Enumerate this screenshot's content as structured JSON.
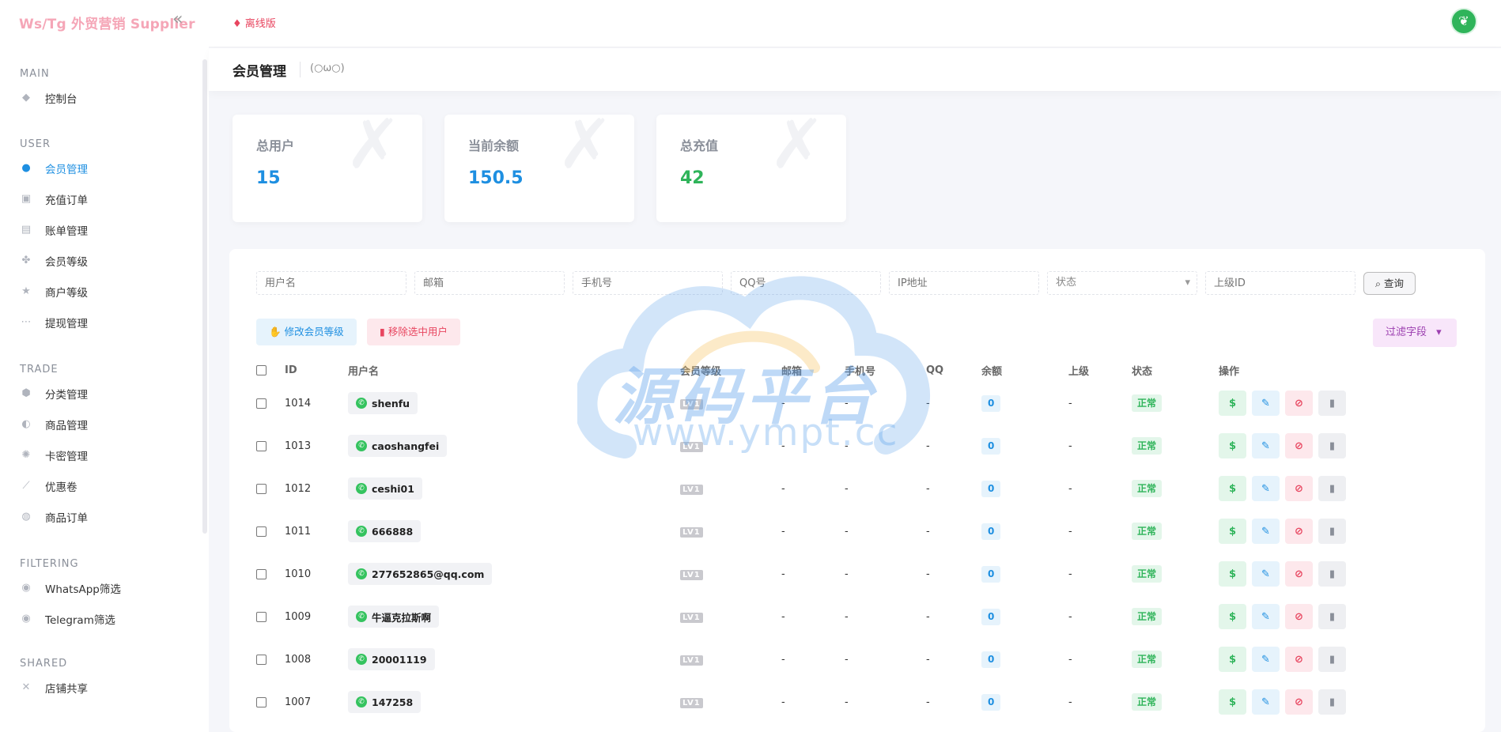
{
  "app": {
    "brand": "Ws/Tg 外贸营销 Supplier",
    "offline_label": "离线版"
  },
  "sidebar": {
    "groups": [
      {
        "title": "MAIN",
        "items": [
          {
            "label": "控制台",
            "icon": "dashboard-icon"
          }
        ]
      },
      {
        "title": "USER",
        "items": [
          {
            "label": "会员管理",
            "icon": "user-icon",
            "active": true
          },
          {
            "label": "充值订单",
            "icon": "recharge-icon"
          },
          {
            "label": "账单管理",
            "icon": "bill-icon"
          },
          {
            "label": "会员等级",
            "icon": "level-icon"
          },
          {
            "label": "商户等级",
            "icon": "merchant-icon"
          },
          {
            "label": "提现管理",
            "icon": "withdraw-icon"
          }
        ]
      },
      {
        "title": "TRADE",
        "items": [
          {
            "label": "分类管理",
            "icon": "category-icon"
          },
          {
            "label": "商品管理",
            "icon": "goods-icon"
          },
          {
            "label": "卡密管理",
            "icon": "card-key-icon"
          },
          {
            "label": "优惠卷",
            "icon": "coupon-icon"
          },
          {
            "label": "商品订单",
            "icon": "order-icon"
          }
        ]
      },
      {
        "title": "FILTERING",
        "items": [
          {
            "label": "WhatsApp筛选",
            "icon": "whatsapp-filter-icon"
          },
          {
            "label": "Telegram筛选",
            "icon": "telegram-filter-icon"
          }
        ]
      },
      {
        "title": "SHARED",
        "items": [
          {
            "label": "店铺共享",
            "icon": "share-icon"
          }
        ]
      }
    ]
  },
  "page": {
    "title": "会员管理",
    "face": "(○ω○)"
  },
  "stats": [
    {
      "label": "总用户",
      "value": "15",
      "color": "#1e8fe1"
    },
    {
      "label": "当前余额",
      "value": "150.5",
      "color": "#1e8fe1"
    },
    {
      "label": "总充值",
      "value": "42",
      "color": "#2fb45a"
    }
  ],
  "filters": {
    "username": "用户名",
    "email": "邮箱",
    "phone": "手机号",
    "qq": "QQ号",
    "ip": "IP地址",
    "status": "状态",
    "parent_id": "上级ID",
    "query_button": "查询"
  },
  "actions": {
    "edit_level": "修改会员等级",
    "remove_selected": "移除选中用户",
    "filter_fields": "过滤字段"
  },
  "table": {
    "columns": [
      "ID",
      "用户名",
      "会员等级",
      "邮箱",
      "手机号",
      "QQ",
      "余额",
      "上级",
      "状态",
      "操作"
    ],
    "rows": [
      {
        "id": "1014",
        "username": "shenfu",
        "level": "LV1",
        "email": "-",
        "phone": "-",
        "qq": "-",
        "balance": "0",
        "parent": "-",
        "status": "正常"
      },
      {
        "id": "1013",
        "username": "caoshangfei",
        "level": "LV1",
        "email": "-",
        "phone": "-",
        "qq": "-",
        "balance": "0",
        "parent": "-",
        "status": "正常"
      },
      {
        "id": "1012",
        "username": "ceshi01",
        "level": "LV1",
        "email": "-",
        "phone": "-",
        "qq": "-",
        "balance": "0",
        "parent": "-",
        "status": "正常"
      },
      {
        "id": "1011",
        "username": "666888",
        "level": "LV1",
        "email": "-",
        "phone": "-",
        "qq": "-",
        "balance": "0",
        "parent": "-",
        "status": "正常"
      },
      {
        "id": "1010",
        "username": "277652865@qq.com",
        "level": "LV1",
        "email": "-",
        "phone": "-",
        "qq": "-",
        "balance": "0",
        "parent": "-",
        "status": "正常"
      },
      {
        "id": "1009",
        "username": "牛逼克拉斯啊",
        "level": "LV1",
        "email": "-",
        "phone": "-",
        "qq": "-",
        "balance": "0",
        "parent": "-",
        "status": "正常"
      },
      {
        "id": "1008",
        "username": "20001119",
        "level": "LV1",
        "email": "-",
        "phone": "-",
        "qq": "-",
        "balance": "0",
        "parent": "-",
        "status": "正常"
      },
      {
        "id": "1007",
        "username": "147258",
        "level": "LV1",
        "email": "-",
        "phone": "-",
        "qq": "-",
        "balance": "0",
        "parent": "-",
        "status": "正常"
      }
    ]
  },
  "watermark": {
    "title": "源码平台",
    "url": "www.ympt.cc"
  }
}
